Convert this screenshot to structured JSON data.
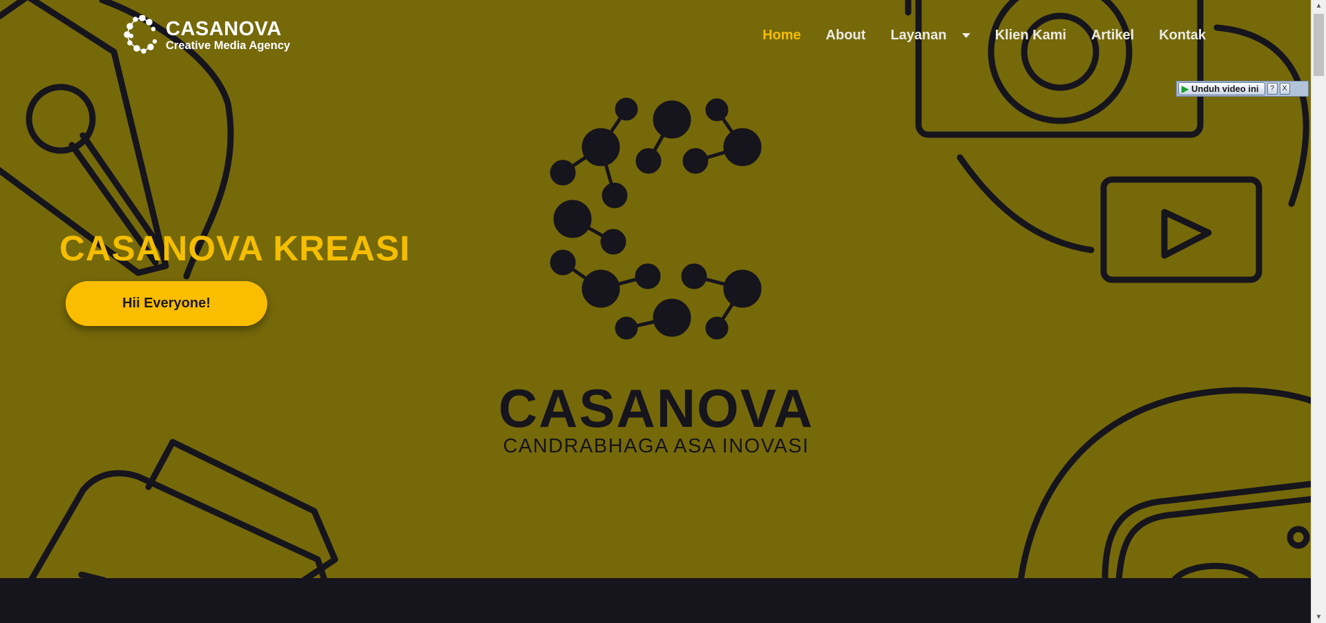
{
  "logo": {
    "title": "CASANOVA",
    "subtitle": "Creative Media Agency",
    "icon": "dotted-c-logo-icon"
  },
  "nav": {
    "items": [
      {
        "label": "Home",
        "active": true
      },
      {
        "label": "About",
        "active": false
      },
      {
        "label": "Layanan",
        "active": false,
        "has_dropdown": true
      },
      {
        "label": "Klien Kami",
        "active": false
      },
      {
        "label": "Artikel",
        "active": false
      },
      {
        "label": "Kontak",
        "active": false
      }
    ]
  },
  "hero": {
    "headline": "CASANOVA KREASI",
    "cta_label": "Hii Everyone!"
  },
  "brand": {
    "name": "CASANOVA",
    "tagline": "CANDRABHAGA ASA INOVASI",
    "emblem_icon": "molecule-c-emblem-icon"
  },
  "addon_toolbar": {
    "download_label": "Unduh video ini",
    "help_label": "?",
    "close_label": "X"
  },
  "background_icons": [
    "pen-nib-icon",
    "camera-icon",
    "play-button-icon",
    "compact-camera-icon",
    "film-reel-icon"
  ],
  "colors": {
    "hero_background": "#76690a",
    "accent_yellow": "#f5be00",
    "dark_ink": "#16141c",
    "nav_text": "#ecebe4"
  }
}
